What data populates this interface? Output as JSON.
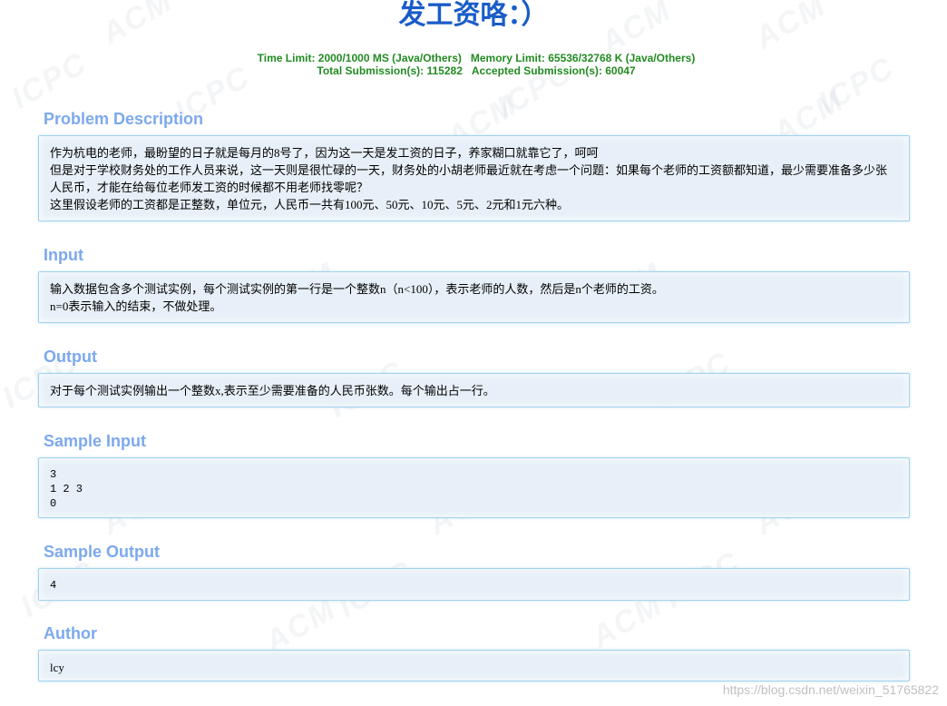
{
  "problem": {
    "title": "发工资咯：）",
    "time_limit": "Time Limit: 2000/1000 MS (Java/Others)",
    "memory_limit": "Memory Limit: 65536/32768 K (Java/Others)",
    "total_submissions": "Total Submission(s): 115282",
    "accepted_submissions": "Accepted Submission(s): 60047"
  },
  "sections": {
    "description": {
      "heading": "Problem Description",
      "lines": [
        "作为杭电的老师，最盼望的日子就是每月的8号了，因为这一天是发工资的日子，养家糊口就靠它了，呵呵",
        "但是对于学校财务处的工作人员来说，这一天则是很忙碌的一天，财务处的小胡老师最近就在考虑一个问题：如果每个老师的工资额都知道，最少需要准备多少张人民币，才能在给每位老师发工资的时候都不用老师找零呢？",
        "这里假设老师的工资都是正整数，单位元，人民币一共有100元、50元、10元、5元、2元和1元六种。"
      ]
    },
    "input": {
      "heading": "Input",
      "lines": [
        "输入数据包含多个测试实例，每个测试实例的第一行是一个整数n（n<100），表示老师的人数，然后是n个老师的工资。",
        "n=0表示输入的结束，不做处理。"
      ]
    },
    "output": {
      "heading": "Output",
      "lines": [
        "对于每个测试实例输出一个整数x,表示至少需要准备的人民币张数。每个输出占一行。"
      ]
    },
    "sample_input": {
      "heading": "Sample Input",
      "text": "3\n1 2 3\n0"
    },
    "sample_output": {
      "heading": "Sample Output",
      "text": "4"
    },
    "author": {
      "heading": "Author",
      "text": "lcy"
    }
  },
  "watermark": {
    "text_a": "ACM",
    "text_b": "ICPC",
    "credit": "https://blog.csdn.net/weixin_51765822"
  }
}
